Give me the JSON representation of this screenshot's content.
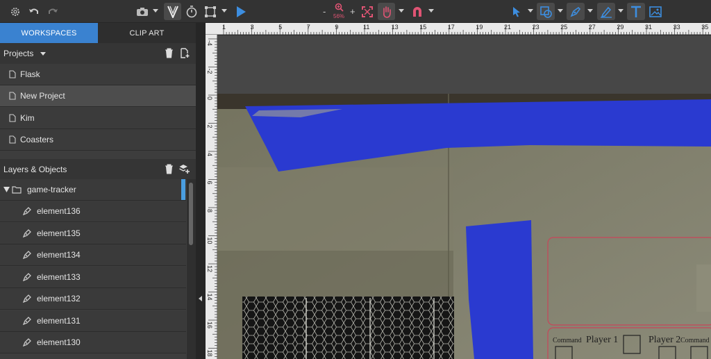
{
  "toolbar": {
    "zoom_minus": "-",
    "zoom_plus": "+",
    "zoom_level": "56%",
    "accent_color": "#e05474",
    "icons": [
      "gear-icon",
      "undo-icon",
      "redo-icon",
      "camera-icon",
      "vector-v-icon",
      "timer-icon",
      "selection-box-icon",
      "play-icon",
      "zoom-icon",
      "fit-screen-icon",
      "hand-icon",
      "magnet-icon",
      "pointer-icon",
      "shape-icon",
      "pen-icon",
      "pen-edit-icon",
      "text-icon",
      "image-icon"
    ]
  },
  "tabs": {
    "workspaces": "WORKSPACES",
    "clip_art": "CLIP ART"
  },
  "projects": {
    "title": "Projects",
    "items": [
      "Flask",
      "New Project",
      "Kim",
      "Coasters"
    ],
    "selected": "New Project"
  },
  "layers": {
    "title": "Layers & Objects",
    "group": "game-tracker",
    "items": [
      "element136",
      "element135",
      "element134",
      "element133",
      "element132",
      "element131",
      "element130"
    ]
  },
  "ruler": {
    "top_ticks": [
      "1",
      "3",
      "5",
      "7",
      "9",
      "11",
      "13",
      "15",
      "17",
      "19",
      "21",
      "23",
      "25",
      "27",
      "29",
      "31",
      "33",
      "35"
    ],
    "left_ticks": [
      "-4",
      "-2",
      "0",
      "2",
      "4",
      "6",
      "8",
      "10",
      "12",
      "14",
      "16",
      "18"
    ]
  },
  "canvas": {
    "board_labels": [
      "Command",
      "Player 1",
      "Player 2",
      "Command"
    ]
  },
  "colors": {
    "tab_active": "#3a82d0",
    "tape_blue": "#2a3ad0",
    "board_outline": "#c8455a"
  }
}
